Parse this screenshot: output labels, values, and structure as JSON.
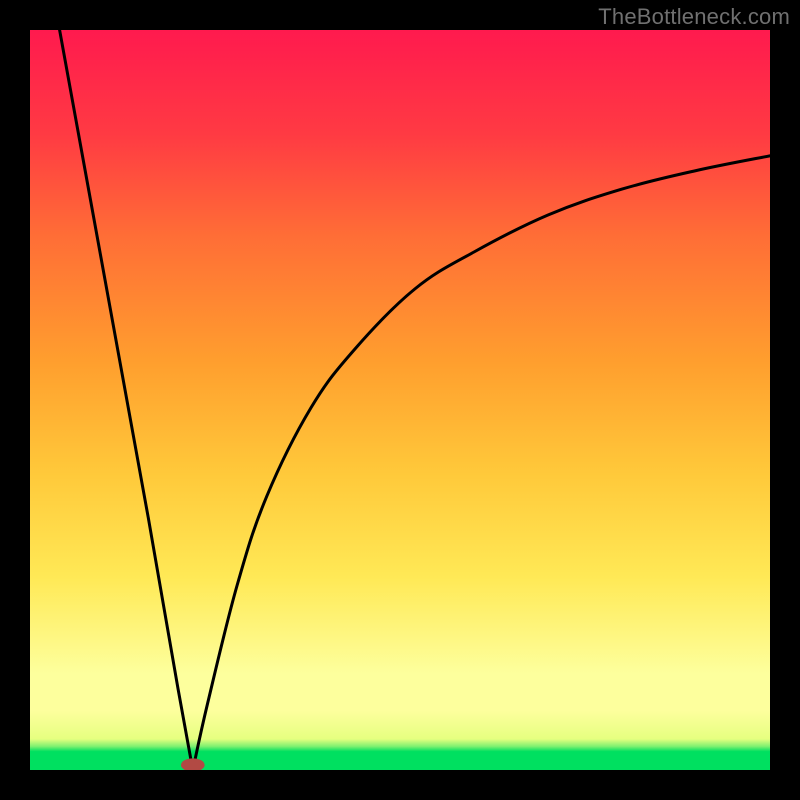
{
  "watermark": "TheBottleneck.com",
  "chart_data": {
    "type": "line",
    "title": "",
    "xlabel": "",
    "ylabel": "",
    "xlim": [
      0,
      100
    ],
    "ylim": [
      0,
      100
    ],
    "grid": false,
    "legend": false,
    "curve_approx": {
      "min_x": 22,
      "min_y": 0,
      "left": {
        "x": 4,
        "y": 100
      },
      "right_end": {
        "x": 100,
        "y": 83
      },
      "type_hint": "V-shaped bottleneck curve: steep linear descent to minimum, then saturating rise"
    },
    "min_marker": {
      "x": 22,
      "y": 0,
      "rx": 1.6,
      "ry": 0.9,
      "color": "#b24a44"
    },
    "series": [
      {
        "name": "bottleneck",
        "x": [
          4,
          8,
          12,
          16,
          20,
          22,
          24,
          28,
          32,
          38,
          44,
          52,
          60,
          70,
          80,
          90,
          100
        ],
        "y": [
          100,
          78,
          56,
          34,
          11,
          0,
          9,
          25,
          37,
          49,
          57,
          65,
          70,
          75,
          78.5,
          81,
          83
        ]
      }
    ],
    "background_bands": [
      {
        "label": "good",
        "y0": 0,
        "y1": 2.5,
        "color": "#00e060"
      },
      {
        "label": "transition",
        "y0": 2.5,
        "y1": 13,
        "color": "#fdff9d"
      },
      {
        "label": "warn-low",
        "y0": 13,
        "y1": 40,
        "color": "#ffe956"
      },
      {
        "label": "warn-high",
        "y0": 40,
        "y1": 70,
        "color": "#ff9f2e"
      },
      {
        "label": "bad",
        "y0": 70,
        "y1": 100,
        "color": "#ff3a43"
      }
    ]
  }
}
